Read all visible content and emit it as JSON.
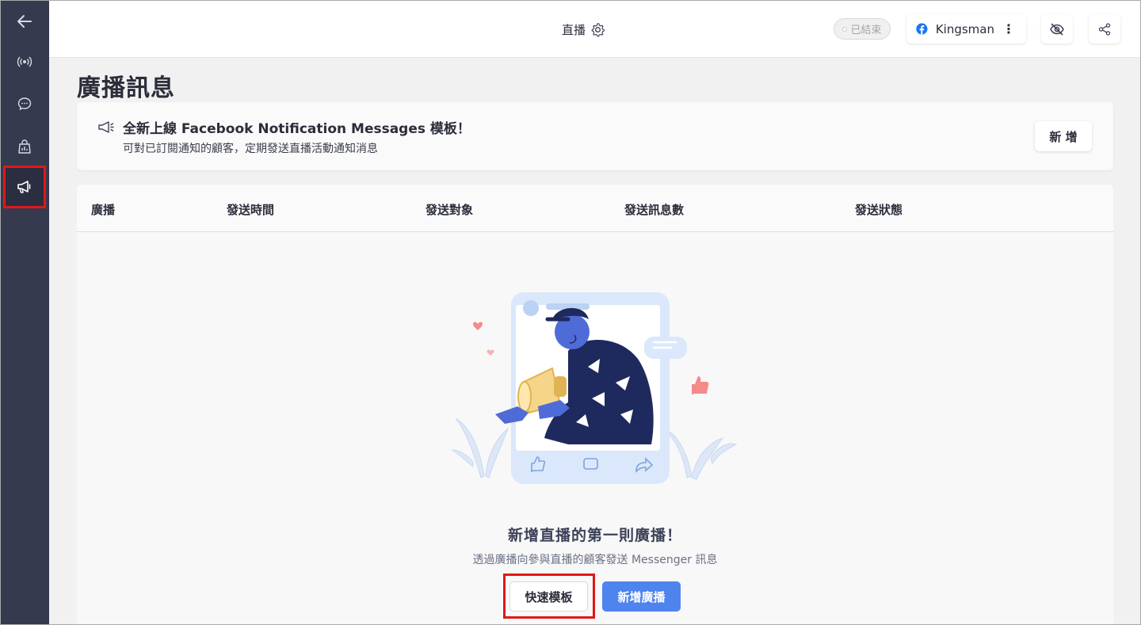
{
  "sidebar": {
    "items": [
      {
        "icon": "back-arrow-icon"
      },
      {
        "icon": "live-broadcast-icon"
      },
      {
        "icon": "chat-bubble-icon"
      },
      {
        "icon": "shopping-bag-icon"
      },
      {
        "icon": "megaphone-icon",
        "active": true
      }
    ]
  },
  "topbar": {
    "title": "直播",
    "status": "已結束",
    "page_name": "Kingsman",
    "page_menu": "⋮"
  },
  "page": {
    "title": "廣播訊息"
  },
  "banner": {
    "title": "全新上線 Facebook Notification Messages 模板！",
    "subtitle": "可對已訂閱通知的顧客，定期發送直播活動通知消息",
    "button": "新 增"
  },
  "table": {
    "columns": [
      "廣播",
      "發送時間",
      "發送對象",
      "發送訊息數",
      "發送狀態"
    ]
  },
  "empty_state": {
    "title": "新增直播的第一則廣播！",
    "subtitle": "透過廣播向參與直播的顧客發送 Messenger 訊息",
    "quick_template_button": "快速模板",
    "new_broadcast_button": "新增廣播"
  },
  "colors": {
    "sidebar_bg": "#353a4f",
    "primary": "#4f83ee",
    "highlight": "#e01818",
    "facebook": "#1877f2"
  }
}
